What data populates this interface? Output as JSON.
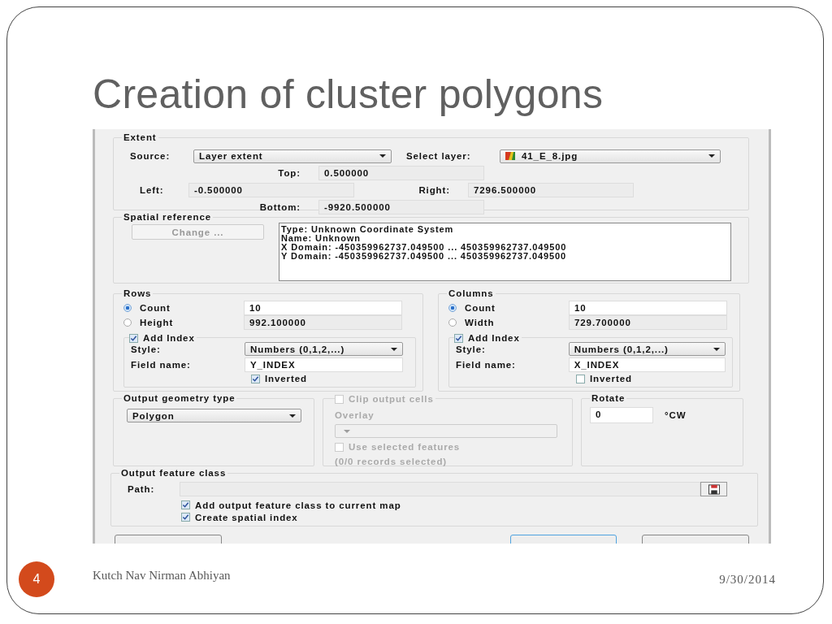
{
  "slide": {
    "title": "Creation of cluster polygons",
    "page_number": "4",
    "footer": "Kutch Nav Nirman Abhiyan",
    "date": "9/30/2014"
  },
  "dialog": {
    "extent": {
      "title": "Extent",
      "source_label": "Source:",
      "source_value": "Layer extent",
      "layer_label": "Select layer:",
      "layer_value": "41_E_8.jpg",
      "fields": [
        {
          "label": "Top:",
          "value": "0.500000"
        },
        {
          "label": "Left:",
          "value": "-0.500000"
        },
        {
          "label": "Right:",
          "value": "7296.500000"
        },
        {
          "label": "Bottom:",
          "value": "-9920.500000"
        }
      ]
    },
    "spatial_reference": {
      "title": "Spatial reference",
      "button": {
        "label": "Change ...",
        "disabled": true
      },
      "lines": [
        "Type: Unknown Coordinate System",
        "Name: Unknown",
        "X Domain: -450359962737.049500 ... 450359962737.049500",
        "Y Domain: -450359962737.049500 ... 450359962737.049500"
      ]
    },
    "grids": [
      {
        "title": "Rows",
        "options": [
          {
            "label": "Count",
            "selected": true,
            "value": "10"
          },
          {
            "label": "Height",
            "selected": false,
            "value": "992.100000"
          }
        ],
        "add_index": {
          "label": "Add Index",
          "checked": true
        },
        "style_label": "Style:",
        "style_value": "Numbers (0,1,2,...)",
        "field_label": "Field name:",
        "field_value": "Y_INDEX",
        "inverted": {
          "label": "Inverted",
          "checked": true
        }
      },
      {
        "title": "Columns",
        "options": [
          {
            "label": "Count",
            "selected": true,
            "value": "10"
          },
          {
            "label": "Width",
            "selected": false,
            "value": "729.700000"
          }
        ],
        "add_index": {
          "label": "Add Index",
          "checked": true
        },
        "style_label": "Style:",
        "style_value": "Numbers (0,1,2,...)",
        "field_label": "Field name:",
        "field_value": "X_INDEX",
        "inverted": {
          "label": "Inverted",
          "checked": false
        }
      }
    ],
    "output_geometry": {
      "title": "Output geometry type",
      "value": "Polygon"
    },
    "clip": {
      "label": "Clip output cells",
      "checked": false,
      "disabled": true,
      "overlay_label": "Overlay",
      "use_selected": {
        "label": "Use selected features",
        "checked": false
      },
      "records": "(0/0 records selected)"
    },
    "rotate": {
      "title": "Rotate",
      "value": "0",
      "unit": "°CW"
    },
    "output_feature_class": {
      "title": "Output feature class",
      "path_label": "Path:",
      "checks": [
        {
          "label": "Add output feature class to current map",
          "checked": true
        },
        {
          "label": "Create spatial index",
          "checked": true
        }
      ]
    }
  }
}
